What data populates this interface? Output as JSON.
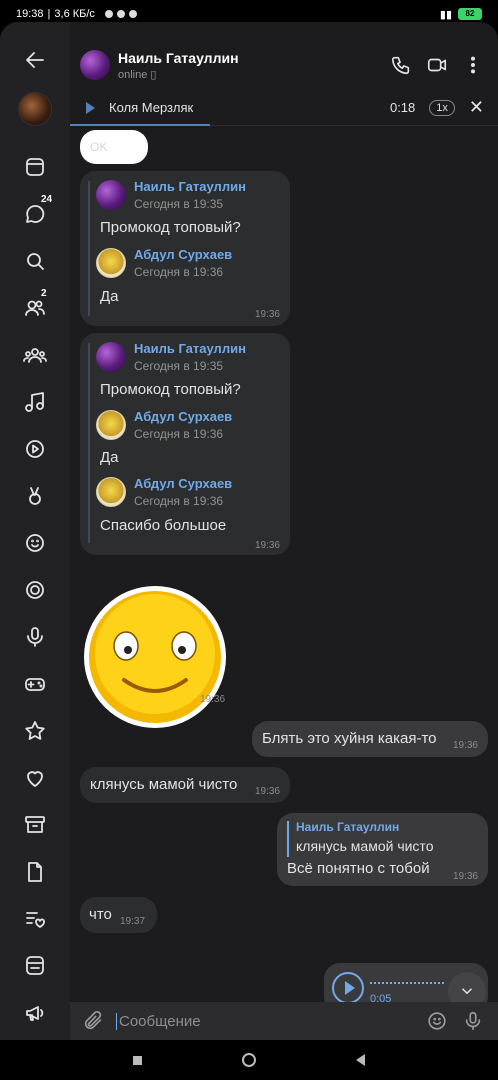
{
  "status_bar": {
    "time": "19:38",
    "network": "3,6 КБ/с",
    "battery": "82"
  },
  "header": {
    "name": "Наиль Гатауллин",
    "status": "online"
  },
  "player": {
    "artist": "Коля Мерзляк",
    "time": "0:18",
    "speed": "1x"
  },
  "rail": {
    "messages_badge": "24",
    "friends_badge": "2"
  },
  "messages": {
    "ok_text": "OK",
    "fwd1": {
      "author1": "Наиль Гатауллин",
      "date1": "Сегодня в 19:35",
      "text1": "Промокод топовый?",
      "author2": "Абдул Сурхаев",
      "date2": "Сегодня в 19:36",
      "text2": "Да",
      "time": "19:36"
    },
    "fwd2": {
      "author1": "Наиль Гатауллин",
      "date1": "Сегодня в 19:35",
      "text1": "Промокод топовый?",
      "author2": "Абдул Сурхаев",
      "date2": "Сегодня в 19:36",
      "text2": "Да",
      "author3": "Абдул Сурхаев",
      "date3": "Сегодня в 19:36",
      "text3": "Спасибо большое",
      "time": "19:36"
    },
    "sticker_time": "19:36",
    "out1": {
      "text": "Блять это хуйня какая-то",
      "time": "19:36"
    },
    "in1": {
      "text": "клянусь мамой чисто",
      "time": "19:36"
    },
    "out2": {
      "reply_author": "Наиль Гатауллин",
      "reply_text": "клянусь мамой чисто",
      "text": "Всё понятно с тобой",
      "time": "19:36"
    },
    "in2": {
      "text": "что",
      "time": "19:37"
    },
    "voice": {
      "duration": "0:05"
    }
  },
  "composer": {
    "placeholder": "Сообщение"
  },
  "colors": {
    "accent": "#71aaeb",
    "background": "#1c1c1e",
    "bubble_in": "#2c2d2e",
    "bubble_out": "#3a3a3c"
  }
}
